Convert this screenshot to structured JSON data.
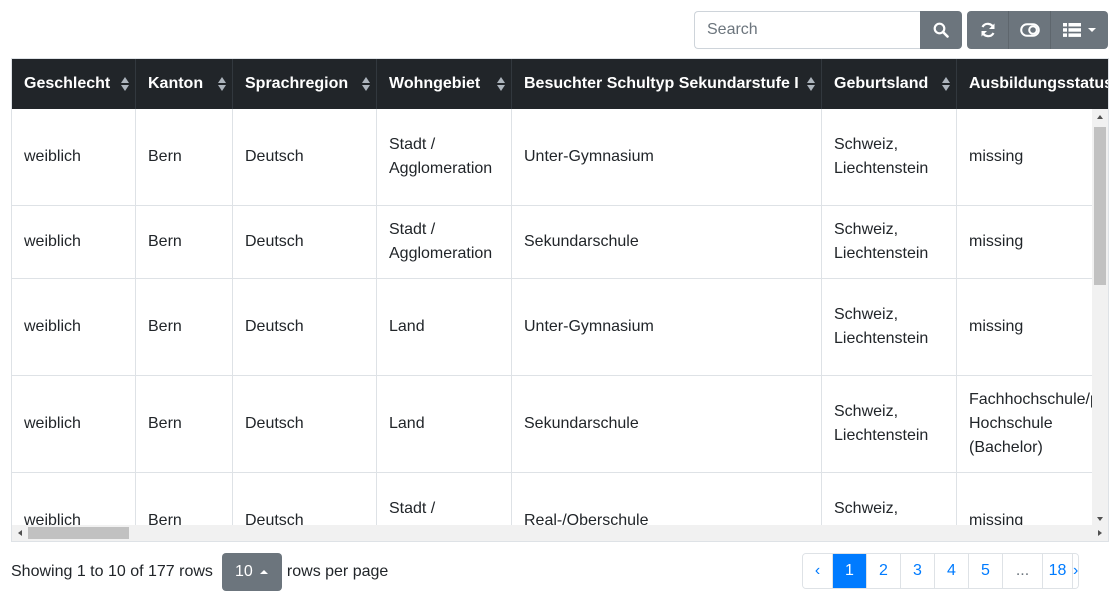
{
  "toolbar": {
    "search_placeholder": "Search",
    "search_value": ""
  },
  "table": {
    "columns": [
      "Geschlecht",
      "Kanton",
      "Sprachregion",
      "Wohngebiet",
      "Besuchter Schultyp Sekundarstufe I",
      "Geburtsland",
      "Ausbildungsstatus"
    ],
    "rows": [
      [
        "weiblich",
        "Bern",
        "Deutsch",
        "Stadt /\nAgglomeration",
        "Unter-Gymnasium",
        "Schweiz,\nLiechtenstein",
        "missing"
      ],
      [
        "weiblich",
        "Bern",
        "Deutsch",
        "Stadt /\nAgglomeration",
        "Sekundarschule",
        "Schweiz,\nLiechtenstein",
        "missing"
      ],
      [
        "weiblich",
        "Bern",
        "Deutsch",
        "Land",
        "Unter-Gymnasium",
        "Schweiz,\nLiechtenstein",
        "missing"
      ],
      [
        "weiblich",
        "Bern",
        "Deutsch",
        "Land",
        "Sekundarschule",
        "Schweiz,\nLiechtenstein",
        "Fachhochschule/p\nHochschule\n(Bachelor)"
      ],
      [
        "weiblich",
        "Bern",
        "Deutsch",
        "Stadt /\nAgglomeration",
        "Real-/Oberschule",
        "Schweiz,\nLiechtenstein",
        "missing"
      ]
    ]
  },
  "footer": {
    "showing_text": "Showing 1 to 10 of 177 rows",
    "page_size": "10",
    "rows_per_page_text": "rows per page"
  },
  "pagination": {
    "prev": "‹",
    "pages": [
      "1",
      "2",
      "3",
      "4",
      "5",
      "...",
      "18"
    ],
    "next": "›",
    "active": "1"
  },
  "colors": {
    "header_bg": "#212529",
    "button_gray": "#6c757d",
    "active_page": "#007bff"
  }
}
